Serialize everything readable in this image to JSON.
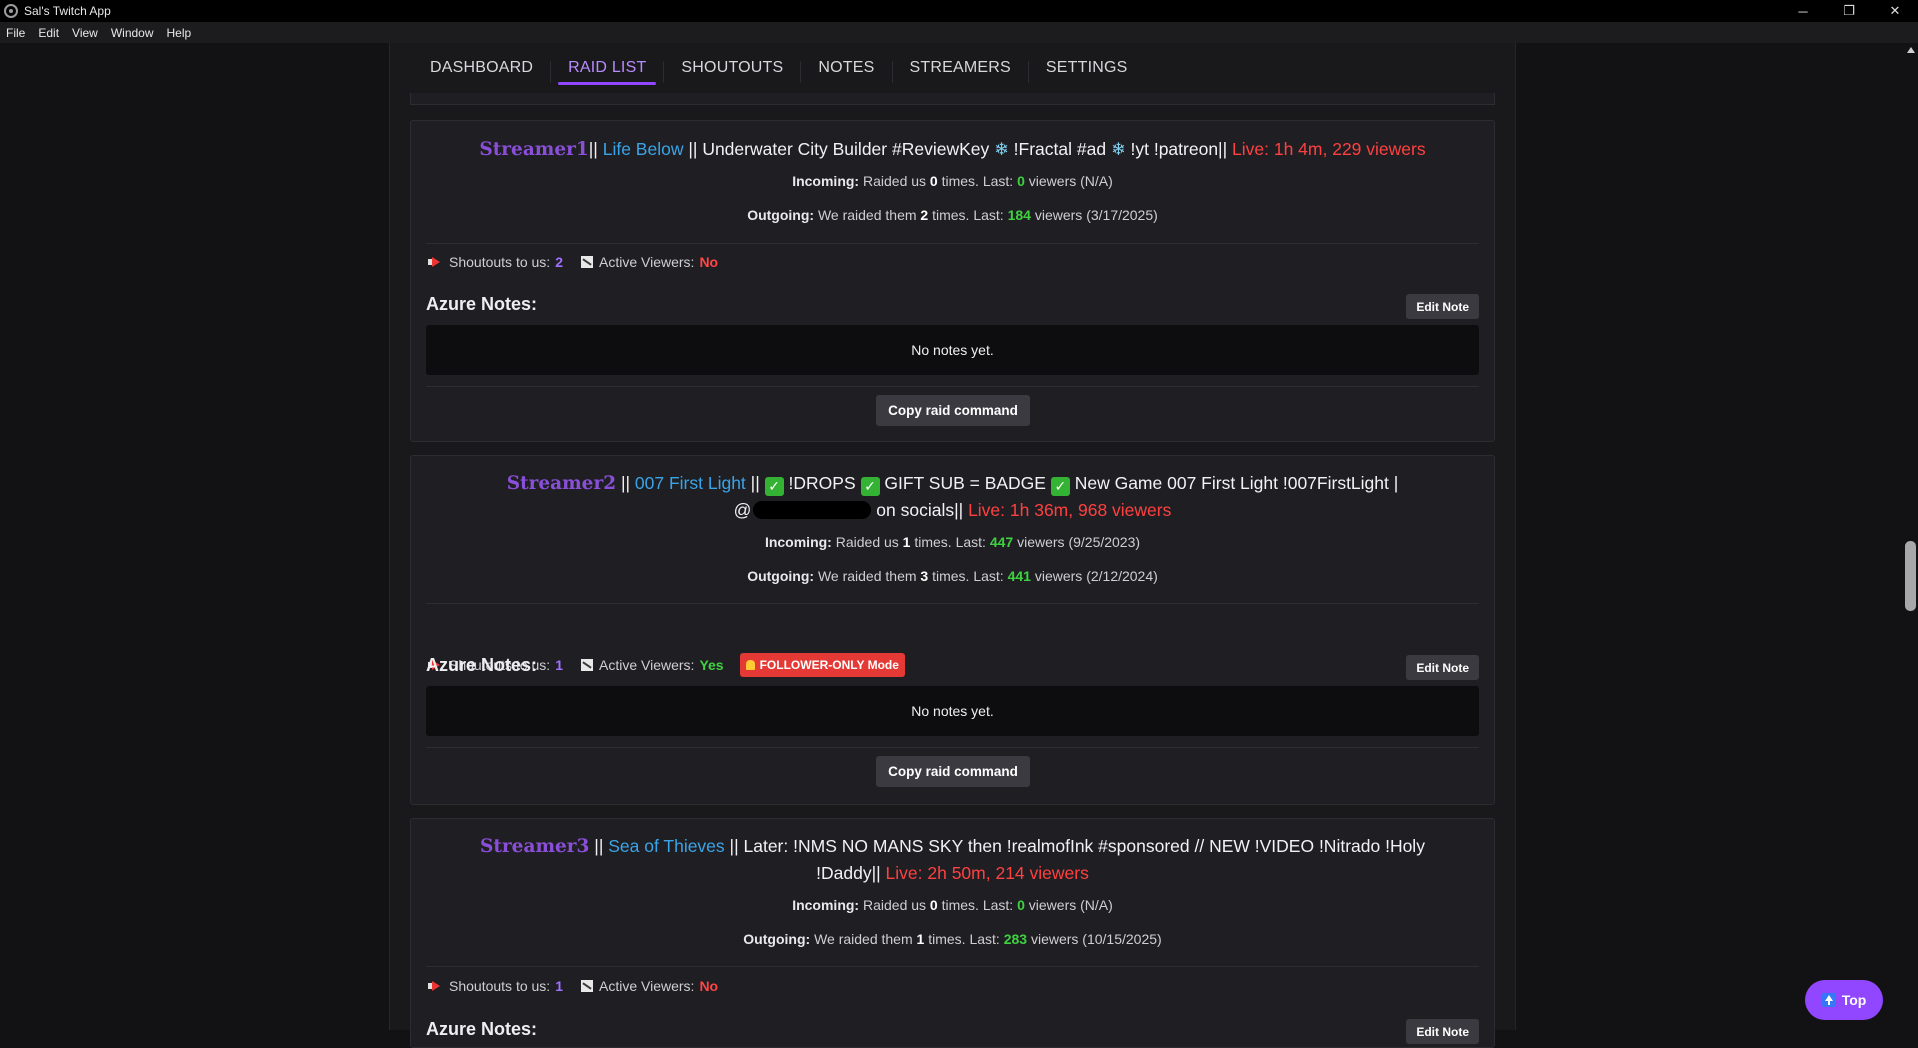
{
  "window": {
    "title": "Sal's Twitch App",
    "controls": {
      "minimize": "─",
      "restore": "❐",
      "close": "✕"
    }
  },
  "menu": [
    "File",
    "Edit",
    "View",
    "Window",
    "Help"
  ],
  "tabs": [
    "DASHBOARD",
    "RAID LIST",
    "SHOUTOUTS",
    "NOTES",
    "STREAMERS",
    "SETTINGS"
  ],
  "active_tab": "RAID LIST",
  "labels": {
    "incoming": "Incoming:",
    "outgoing": "Outgoing:",
    "shoutouts": "Shoutouts to us:",
    "active_viewers": "Active Viewers:",
    "azure_notes": "Azure Notes:",
    "edit_note": "Edit Note",
    "no_notes": "No notes yet.",
    "copy_raid": "Copy raid command",
    "top": "Top"
  },
  "cards": [
    {
      "name": "Streamer1",
      "sep1": "||",
      "game": "Life Below",
      "title_a": "|| Underwater City Builder #ReviewKey",
      "snow1": "❄",
      "title_b": "!Fractal #ad",
      "snow2": "❄",
      "title_c": "!yt !patreon||",
      "live": "Live: 1h 4m, 229 viewers",
      "incoming": {
        "pre": "Raided us",
        "times": "0",
        "mid": "times. Last:",
        "viewers": "0",
        "post": "viewers (N/A)"
      },
      "outgoing": {
        "pre": "We raided them",
        "times": "2",
        "mid": "times. Last:",
        "viewers": "184",
        "post": "viewers (3/17/2025)"
      },
      "shoutouts": "2",
      "active_viewers": "No"
    },
    {
      "name": "Streamer2",
      "sep1": "||",
      "game": "007 First Light",
      "title_a": "||",
      "title_b": "!DROPS",
      "title_c": "GIFT SUB = BADGE",
      "title_d": "New Game 007 First Light !007FirstLight |",
      "title_e": "@",
      "title_f": "on socials||",
      "live": "Live: 1h 36m, 968 viewers",
      "incoming": {
        "pre": "Raided us",
        "times": "1",
        "mid": "times. Last:",
        "viewers": "447",
        "post": "viewers (9/25/2023)"
      },
      "outgoing": {
        "pre": "We raided them",
        "times": "3",
        "mid": "times. Last:",
        "viewers": "441",
        "post": "viewers (2/12/2024)"
      },
      "shoutouts": "1",
      "active_viewers": "Yes",
      "badge": "FOLLOWER-ONLY Mode"
    },
    {
      "name": "Streamer3",
      "sep1": "||",
      "game": "Sea of Thieves",
      "title_a": "|| Later: !NMS NO MANS SKY then !realmofInk #sponsored // NEW !VIDEO !Nitrado !Holy",
      "title_b": "!Daddy||",
      "live": "Live: 2h 50m, 214 viewers",
      "incoming": {
        "pre": "Raided us",
        "times": "0",
        "mid": "times. Last:",
        "viewers": "0",
        "post": "viewers (N/A)"
      },
      "outgoing": {
        "pre": "We raided them",
        "times": "1",
        "mid": "times. Last:",
        "viewers": "283",
        "post": "viewers (10/15/2025)"
      },
      "shoutouts": "1",
      "active_viewers": "No",
      "notes_label_partial": "Azure Notes:",
      "edit_note_partial": "Edit Note"
    }
  ],
  "colors": {
    "accent": "#9147ff",
    "streamer": "#8a4fd8",
    "game": "#3aa4e8",
    "live": "#ff4040",
    "green": "#3fd13f",
    "badge": "#e53935"
  }
}
